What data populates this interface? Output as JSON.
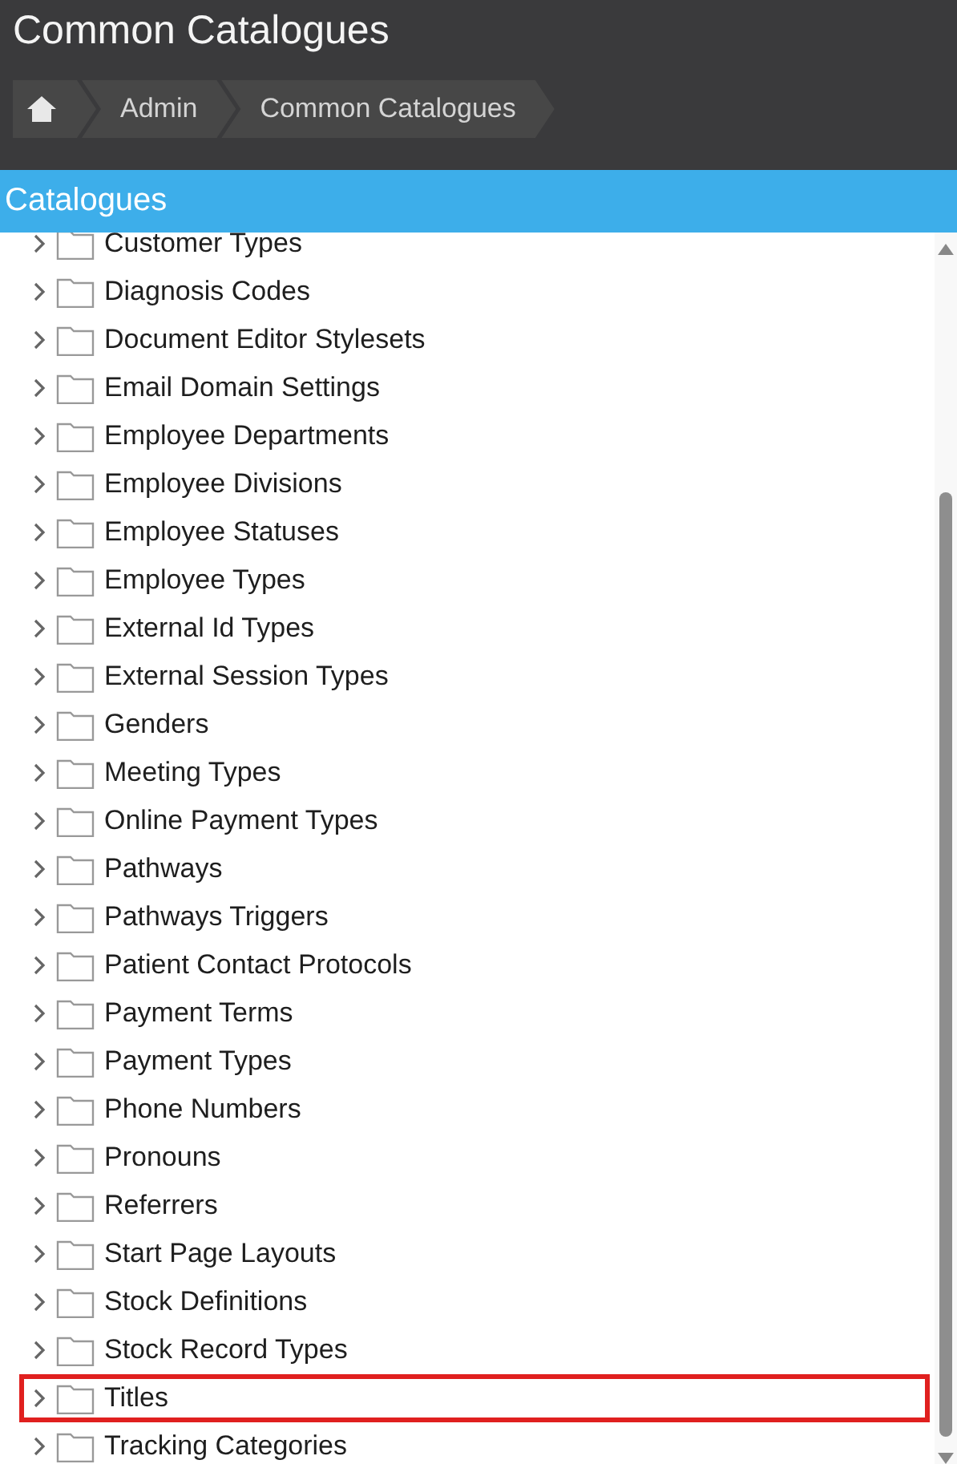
{
  "header": {
    "title": "Common Catalogues"
  },
  "breadcrumbs": [
    {
      "kind": "home"
    },
    {
      "kind": "text",
      "label": "Admin"
    },
    {
      "kind": "text",
      "label": "Common Catalogues"
    }
  ],
  "panel": {
    "title": "Catalogues"
  },
  "tree": [
    {
      "label": "Customer Types",
      "highlighted": false
    },
    {
      "label": "Diagnosis Codes",
      "highlighted": false
    },
    {
      "label": "Document Editor Stylesets",
      "highlighted": false
    },
    {
      "label": "Email Domain Settings",
      "highlighted": false
    },
    {
      "label": "Employee Departments",
      "highlighted": false
    },
    {
      "label": "Employee Divisions",
      "highlighted": false
    },
    {
      "label": "Employee Statuses",
      "highlighted": false
    },
    {
      "label": "Employee Types",
      "highlighted": false
    },
    {
      "label": "External Id Types",
      "highlighted": false
    },
    {
      "label": "External Session Types",
      "highlighted": false
    },
    {
      "label": "Genders",
      "highlighted": false
    },
    {
      "label": "Meeting Types",
      "highlighted": false
    },
    {
      "label": "Online Payment Types",
      "highlighted": false
    },
    {
      "label": "Pathways",
      "highlighted": false
    },
    {
      "label": "Pathways Triggers",
      "highlighted": false
    },
    {
      "label": "Patient Contact Protocols",
      "highlighted": false
    },
    {
      "label": "Payment Terms",
      "highlighted": false
    },
    {
      "label": "Payment Types",
      "highlighted": false
    },
    {
      "label": "Phone Numbers",
      "highlighted": false
    },
    {
      "label": "Pronouns",
      "highlighted": false
    },
    {
      "label": "Referrers",
      "highlighted": false
    },
    {
      "label": "Start Page Layouts",
      "highlighted": false
    },
    {
      "label": "Stock Definitions",
      "highlighted": false
    },
    {
      "label": "Stock Record Types",
      "highlighted": false
    },
    {
      "label": "Titles",
      "highlighted": true
    },
    {
      "label": "Tracking Categories",
      "highlighted": false
    }
  ]
}
